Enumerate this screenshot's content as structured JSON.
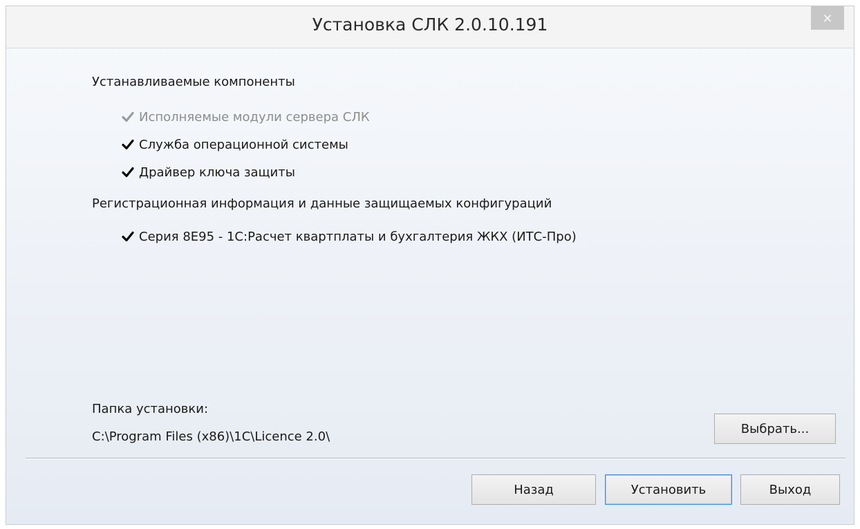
{
  "window": {
    "title": "Установка СЛК 2.0.10.191",
    "close_glyph": "×"
  },
  "components": {
    "heading": "Устанавливаемые компоненты",
    "items": [
      {
        "label": "Исполняемые модули сервера СЛК",
        "checked": true,
        "disabled": true
      },
      {
        "label": "Служба операционной системы",
        "checked": true,
        "disabled": false
      },
      {
        "label": "Драйвер ключа защиты",
        "checked": true,
        "disabled": false
      }
    ]
  },
  "registration": {
    "heading": "Регистрационная информация и данные защищаемых конфигураций",
    "items": [
      {
        "label": "Серия 8E95 - 1С:Расчет квартплаты и бухгалтерия ЖКХ (ИТС-Про)",
        "checked": true,
        "disabled": false
      }
    ]
  },
  "install_folder": {
    "label": "Папка установки:",
    "path": "C:\\Program Files (x86)\\1C\\Licence 2.0\\",
    "browse_label": "Выбрать..."
  },
  "footer": {
    "back_label": "Назад",
    "install_label": "Установить",
    "exit_label": "Выход"
  },
  "colors": {
    "checkmark": "#000000",
    "checkmark_disabled": "#9a9a9a",
    "default_button_border": "#3c8fdf"
  }
}
